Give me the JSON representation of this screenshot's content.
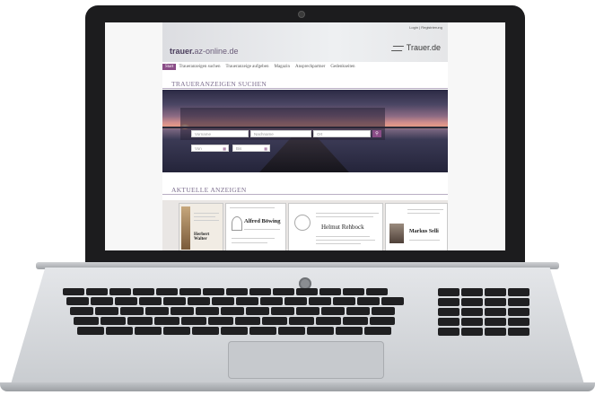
{
  "site": {
    "logo_domain": "trauer.",
    "logo_rest": "az-online.de",
    "brand": "Trauer.de",
    "login_links": "Login | Registrierung"
  },
  "nav": {
    "items": [
      {
        "label": "Start",
        "active": true
      },
      {
        "label": "Traueranzeigen suchen"
      },
      {
        "label": "Traueranzeige aufgeben"
      },
      {
        "label": "Magazin"
      },
      {
        "label": "Ansprechpartner"
      },
      {
        "label": "Gedenkseiten"
      }
    ]
  },
  "search": {
    "title": "TRAUERANZEIGEN SUCHEN",
    "vorname": "Vorname",
    "nachname": "Nachname",
    "ort": "Ort",
    "von": "Von",
    "bis": "Bis",
    "search_icon": "search-icon",
    "calendar_icon": "calendar-icon"
  },
  "ads": {
    "title": "AKTUELLE ANZEIGEN",
    "cards": [
      {
        "name": "Herbert Walter"
      },
      {
        "name": "Alfred Böwing"
      },
      {
        "name": "Helmut Rehbock"
      },
      {
        "name": "Markus Selli"
      }
    ]
  },
  "colors": {
    "accent": "#8a4d87",
    "heading": "#7d6f8f",
    "laptop_bezel": "#1c1c1e"
  }
}
